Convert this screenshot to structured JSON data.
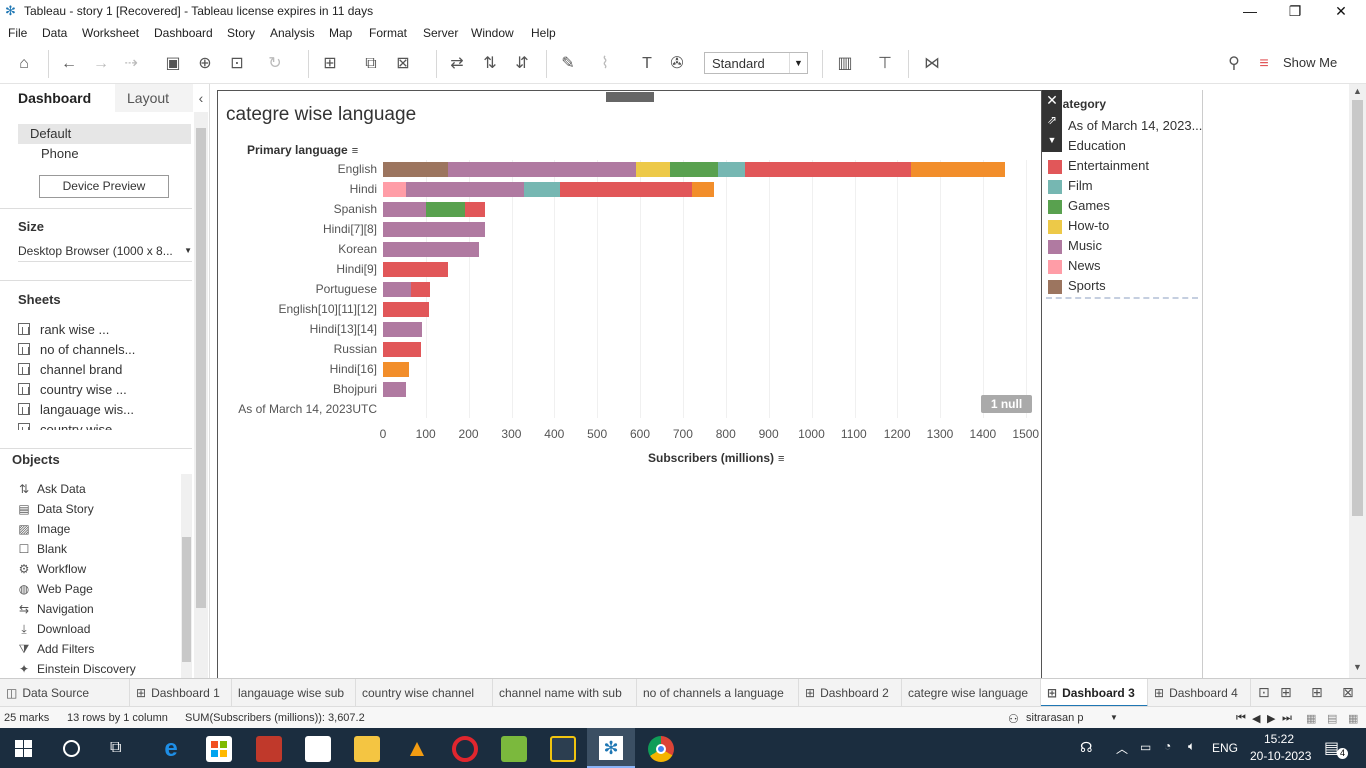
{
  "window": {
    "title": "Tableau - story 1 [Recovered] - Tableau license expires in 11 days",
    "minimize": "—",
    "restore": "❐",
    "close": "✕"
  },
  "menu": [
    "File",
    "Data",
    "Worksheet",
    "Dashboard",
    "Story",
    "Analysis",
    "Map",
    "Format",
    "Server",
    "Window",
    "Help"
  ],
  "toolbar": {
    "fit_select": "Standard",
    "show_me": "Show Me"
  },
  "left_panel": {
    "tab_dashboard": "Dashboard",
    "tab_layout": "Layout",
    "collapse": "‹",
    "devices": [
      "Default",
      "Phone"
    ],
    "device_preview": "Device Preview",
    "size_title": "Size",
    "size_value": "Desktop Browser (1000 x 8...",
    "sheets_title": "Sheets",
    "sheets": [
      "rank wise ...",
      "no of channels...",
      "channel brand",
      "country wise ...",
      "langauage wis...",
      "country wise ..."
    ],
    "objects_title": "Objects",
    "objects": [
      {
        "icon": "ask-data-icon",
        "glyph": "⇅",
        "label": "Ask Data"
      },
      {
        "icon": "data-story-icon",
        "glyph": "▤",
        "label": "Data Story"
      },
      {
        "icon": "image-icon",
        "glyph": "▨",
        "label": "Image"
      },
      {
        "icon": "blank-icon",
        "glyph": "☐",
        "label": "Blank"
      },
      {
        "icon": "workflow-icon",
        "glyph": "⚙",
        "label": "Workflow"
      },
      {
        "icon": "web-page-icon",
        "glyph": "◍",
        "label": "Web Page"
      },
      {
        "icon": "navigation-icon",
        "glyph": "⇆",
        "label": "Navigation"
      },
      {
        "icon": "download-icon",
        "glyph": "⤓",
        "label": "Download"
      },
      {
        "icon": "add-filters-icon",
        "glyph": "⧩",
        "label": "Add Filters"
      },
      {
        "icon": "einstein-discovery-icon",
        "glyph": "✦",
        "label": "Einstein Discovery"
      }
    ]
  },
  "dashboard": {
    "title": "categre wise language",
    "row_header": "Primary language",
    "x_axis_title": "Subscribers (millions)",
    "null_badge": "1 null"
  },
  "legend": {
    "title": "Category",
    "items": [
      {
        "label": "As of March 14, 2023...",
        "color": null
      },
      {
        "label": "Education",
        "color": null
      },
      {
        "label": "Entertainment",
        "color": "#e15759"
      },
      {
        "label": "Film",
        "color": "#76b7b2"
      },
      {
        "label": "Games",
        "color": "#59a14f"
      },
      {
        "label": "How-to",
        "color": "#edc948"
      },
      {
        "label": "Music",
        "color": "#b07aa1"
      },
      {
        "label": "News",
        "color": "#ff9da7"
      },
      {
        "label": "Sports",
        "color": "#9c755f"
      }
    ],
    "education_color": "#f28e2b"
  },
  "chart_data": {
    "type": "bar",
    "orientation": "horizontal-stacked",
    "title": "categre wise language",
    "xlabel": "Subscribers (millions)",
    "ylabel": "Primary language",
    "xlim": [
      0,
      1500
    ],
    "xticks": [
      "0",
      "100",
      "200",
      "300",
      "400",
      "500",
      "600",
      "700",
      "800",
      "900",
      "1000",
      "1100",
      "1200",
      "1300",
      "1400",
      "1500"
    ],
    "categories": [
      "English",
      "Hindi",
      "Spanish",
      "Hindi[7][8]",
      "Korean",
      "Hindi[9]",
      "Portuguese",
      "English[10][11][12]",
      "Hindi[13][14]",
      "Russian",
      "Hindi[16]",
      "Bhojpuri",
      "As of March 14, 2023UTC"
    ],
    "series": [
      {
        "name": "Sports",
        "color": "#9c755f",
        "values": [
          152,
          0,
          0,
          0,
          0,
          0,
          0,
          0,
          0,
          0,
          0,
          0,
          0
        ]
      },
      {
        "name": "News",
        "color": "#ff9da7",
        "values": [
          0,
          53,
          0,
          0,
          0,
          0,
          0,
          0,
          0,
          0,
          0,
          0,
          0
        ]
      },
      {
        "name": "Music",
        "color": "#b07aa1",
        "values": [
          438,
          277,
          100,
          238,
          225,
          0,
          66,
          0,
          91,
          0,
          0,
          54,
          0
        ]
      },
      {
        "name": "How-to",
        "color": "#edc948",
        "values": [
          80,
          0,
          0,
          0,
          0,
          0,
          0,
          0,
          0,
          0,
          0,
          0,
          0
        ]
      },
      {
        "name": "Games",
        "color": "#59a14f",
        "values": [
          112,
          0,
          91,
          0,
          0,
          0,
          0,
          0,
          0,
          0,
          0,
          0,
          0
        ]
      },
      {
        "name": "Film",
        "color": "#76b7b2",
        "values": [
          62,
          84,
          0,
          0,
          0,
          0,
          0,
          0,
          0,
          0,
          0,
          0,
          0
        ]
      },
      {
        "name": "Entertainment",
        "color": "#e15759",
        "values": [
          387,
          308,
          48,
          0,
          0,
          151,
          44,
          108,
          0,
          88,
          0,
          0,
          0
        ]
      },
      {
        "name": "Education",
        "color": "#f28e2b",
        "values": [
          219,
          50,
          0,
          0,
          0,
          0,
          0,
          0,
          0,
          0,
          60,
          0,
          0
        ]
      }
    ],
    "null_count": "1 null",
    "grid": true
  },
  "tabs": [
    {
      "label": "Data Source",
      "icon": "data-source-icon",
      "glyph": "◫",
      "active": false
    },
    {
      "label": "Dashboard 1",
      "icon": "dashboard-icon",
      "glyph": "⊞",
      "active": false
    },
    {
      "label": "langauage wise sub",
      "icon": null,
      "glyph": "",
      "active": false
    },
    {
      "label": "country  wise channel",
      "icon": null,
      "glyph": "",
      "active": false
    },
    {
      "label": "channel name with sub",
      "icon": null,
      "glyph": "",
      "active": false
    },
    {
      "label": "no of channels a language",
      "icon": null,
      "glyph": "",
      "active": false
    },
    {
      "label": "Dashboard 2",
      "icon": "dashboard-icon",
      "glyph": "⊞",
      "active": false
    },
    {
      "label": "categre wise language",
      "icon": null,
      "glyph": "",
      "active": false
    },
    {
      "label": "Dashboard 3",
      "icon": "dashboard-icon",
      "glyph": "⊞",
      "active": true
    },
    {
      "label": "Dashboard 4",
      "icon": "dashboard-icon",
      "glyph": "⊞",
      "active": false
    }
  ],
  "status": {
    "marks": "25 marks",
    "rows": "13 rows by 1 column",
    "sum": "SUM(Subscribers (millions)): 3,607.2",
    "user": "sitrarasan p"
  },
  "taskbar": {
    "lang": "ENG",
    "time": "15:22",
    "date": "20-10-2023",
    "notifications": "4"
  }
}
